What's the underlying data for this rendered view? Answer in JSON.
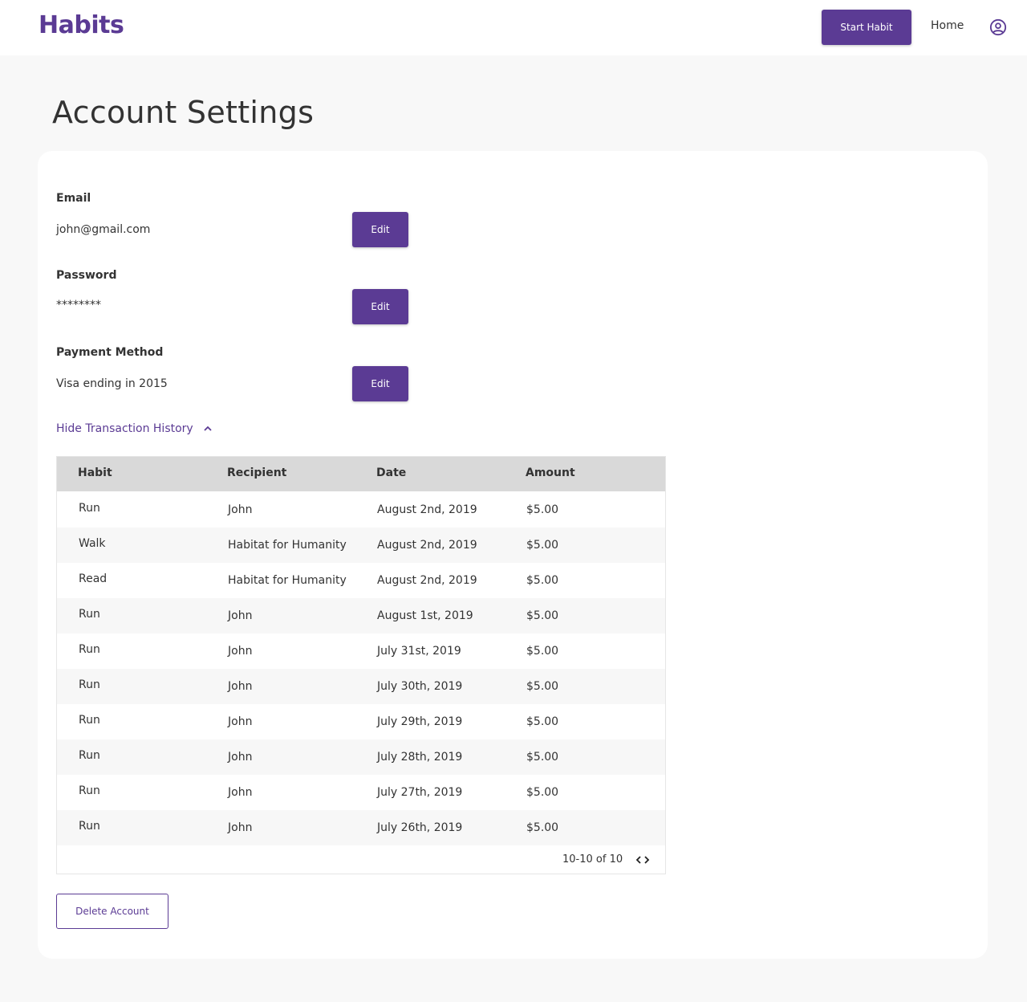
{
  "header": {
    "logo": "Habits",
    "start_button": "Start Habit",
    "home_link": "Home",
    "account_icon": "user-circle-icon"
  },
  "page": {
    "title": "Account Settings"
  },
  "settings": {
    "email": {
      "label": "Email",
      "value": "john@gmail.com",
      "edit_label": "Edit"
    },
    "password": {
      "label": "Password",
      "value": "********",
      "edit_label": "Edit"
    },
    "payment": {
      "label": "Payment Method",
      "value": "Visa ending in 2015",
      "edit_label": "Edit"
    }
  },
  "history": {
    "toggle_label": "Hide Transaction History",
    "toggle_icon": "chevron-up-icon",
    "columns": [
      "Habit",
      "Recipient",
      "Date",
      "Amount"
    ],
    "rows": [
      [
        "Run",
        "John",
        "August 2nd, 2019",
        "$5.00"
      ],
      [
        "Walk",
        "Habitat for Humanity",
        "August 2nd, 2019",
        "$5.00"
      ],
      [
        "Read",
        "Habitat for Humanity",
        "August 2nd, 2019",
        "$5.00"
      ],
      [
        "Run",
        "John",
        "August 1st, 2019",
        "$5.00"
      ],
      [
        "Run",
        "John",
        "July 31st, 2019",
        "$5.00"
      ],
      [
        "Run",
        "John",
        "July 30th, 2019",
        "$5.00"
      ],
      [
        "Run",
        "John",
        "July 29th, 2019",
        "$5.00"
      ],
      [
        "Run",
        "John",
        "July 28th, 2019",
        "$5.00"
      ],
      [
        "Run",
        "John",
        "July 27th, 2019",
        "$5.00"
      ],
      [
        "Run",
        "John",
        "July 26th, 2019",
        "$5.00"
      ]
    ],
    "pagination": "10-10 of 10",
    "pagination_icon": "prev-next-arrows-icon"
  },
  "delete_button": "Delete Account",
  "colors": {
    "brand": "#5b3b94",
    "page_bg": "#f8f8f8",
    "header_row_bg": "#d9d9d9"
  }
}
